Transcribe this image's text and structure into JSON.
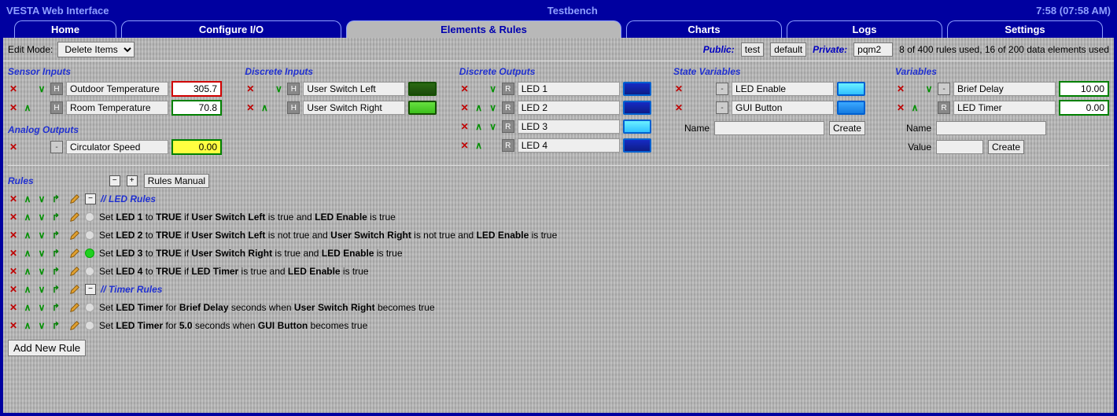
{
  "header": {
    "title": "VESTA Web Interface",
    "center": "Testbench",
    "clock": "7:58 (07:58 AM)"
  },
  "tabs": [
    "Home",
    "Configure I/O",
    "Elements & Rules",
    "Charts",
    "Logs",
    "Settings"
  ],
  "toolbar": {
    "edit_mode_label": "Edit Mode:",
    "edit_mode_value": "Delete Items",
    "public_label": "Public:",
    "btn_test": "test",
    "btn_default": "default",
    "private_label": "Private:",
    "private_value": "pqm2",
    "usage": "8 of 400 rules used,   16 of 200 data elements used"
  },
  "sections": {
    "sensor_inputs": {
      "title": "Sensor Inputs",
      "rows": [
        {
          "badge": "H",
          "name": "Outdoor Temperature",
          "value": "305.7",
          "border": "red"
        },
        {
          "badge": "H",
          "name": "Room Temperature",
          "value": "70.8",
          "border": "green"
        }
      ]
    },
    "analog_outputs": {
      "title": "Analog Outputs",
      "rows": [
        {
          "badge": "-",
          "name": "Circulator Speed",
          "value": "0.00",
          "border": "green",
          "yellow": true
        }
      ]
    },
    "discrete_inputs": {
      "title": "Discrete Inputs",
      "rows": [
        {
          "badge": "H",
          "name": "User Switch Left",
          "swatch": "darkgreen"
        },
        {
          "badge": "H",
          "name": "User Switch Right",
          "swatch": "green"
        }
      ]
    },
    "discrete_outputs": {
      "title": "Discrete Outputs",
      "rows": [
        {
          "badge": "R",
          "name": "LED 1",
          "swatch": "navy"
        },
        {
          "badge": "R",
          "name": "LED 2",
          "swatch": "navy"
        },
        {
          "badge": "R",
          "name": "LED 3",
          "swatch": "on"
        },
        {
          "badge": "R",
          "name": "LED 4",
          "swatch": "navy"
        }
      ]
    },
    "state_variables": {
      "title": "State Variables",
      "rows": [
        {
          "badge": "-",
          "name": "LED Enable",
          "swatch": "on"
        },
        {
          "badge": "-",
          "name": "GUI Button",
          "swatch": "mid"
        }
      ],
      "form": {
        "name_label": "Name",
        "create": "Create"
      }
    },
    "variables": {
      "title": "Variables",
      "rows": [
        {
          "badge": "-",
          "name": "Brief Delay",
          "value": "10.00",
          "border": "green"
        },
        {
          "badge": "R",
          "name": "LED Timer",
          "value": "0.00",
          "border": "green"
        }
      ],
      "form": {
        "name_label": "Name",
        "value_label": "Value",
        "create": "Create"
      }
    }
  },
  "rules": {
    "title": "Rules",
    "manual": "Rules Manual",
    "add": "Add New Rule",
    "list": [
      {
        "type": "comment",
        "text": "// LED Rules",
        "collapse": true
      },
      {
        "type": "rule",
        "active": false,
        "parts": [
          "Set ",
          [
            "b",
            "LED 1"
          ],
          " to ",
          [
            "b",
            "TRUE"
          ],
          " if ",
          [
            "b",
            "User Switch Left"
          ],
          " is true and ",
          [
            "b",
            "LED Enable"
          ],
          " is true"
        ]
      },
      {
        "type": "rule",
        "active": false,
        "parts": [
          "Set ",
          [
            "b",
            "LED 2"
          ],
          " to ",
          [
            "b",
            "TRUE"
          ],
          " if ",
          [
            "b",
            "User Switch Left"
          ],
          " is not true and ",
          [
            "b",
            "User Switch Right"
          ],
          " is not true and ",
          [
            "b",
            "LED Enable"
          ],
          " is true"
        ]
      },
      {
        "type": "rule",
        "active": true,
        "parts": [
          "Set ",
          [
            "b",
            "LED 3"
          ],
          " to ",
          [
            "b",
            "TRUE"
          ],
          " if ",
          [
            "b",
            "User Switch Right"
          ],
          " is true and ",
          [
            "b",
            "LED Enable"
          ],
          " is true"
        ]
      },
      {
        "type": "rule",
        "active": false,
        "parts": [
          "Set ",
          [
            "b",
            "LED 4"
          ],
          " to ",
          [
            "b",
            "TRUE"
          ],
          " if ",
          [
            "b",
            "LED Timer"
          ],
          " is true and ",
          [
            "b",
            "LED Enable"
          ],
          " is true"
        ]
      },
      {
        "type": "comment",
        "text": "// Timer Rules",
        "collapse": true
      },
      {
        "type": "rule",
        "active": false,
        "parts": [
          "Set ",
          [
            "b",
            "LED Timer"
          ],
          " for ",
          [
            "b",
            "Brief Delay"
          ],
          " seconds when ",
          [
            "b",
            "User Switch Right"
          ],
          " becomes true"
        ]
      },
      {
        "type": "rule",
        "active": false,
        "parts": [
          "Set ",
          [
            "b",
            "LED Timer"
          ],
          " for ",
          [
            "b",
            "5.0"
          ],
          " seconds when ",
          [
            "b",
            "GUI Button"
          ],
          " becomes true"
        ]
      }
    ]
  }
}
